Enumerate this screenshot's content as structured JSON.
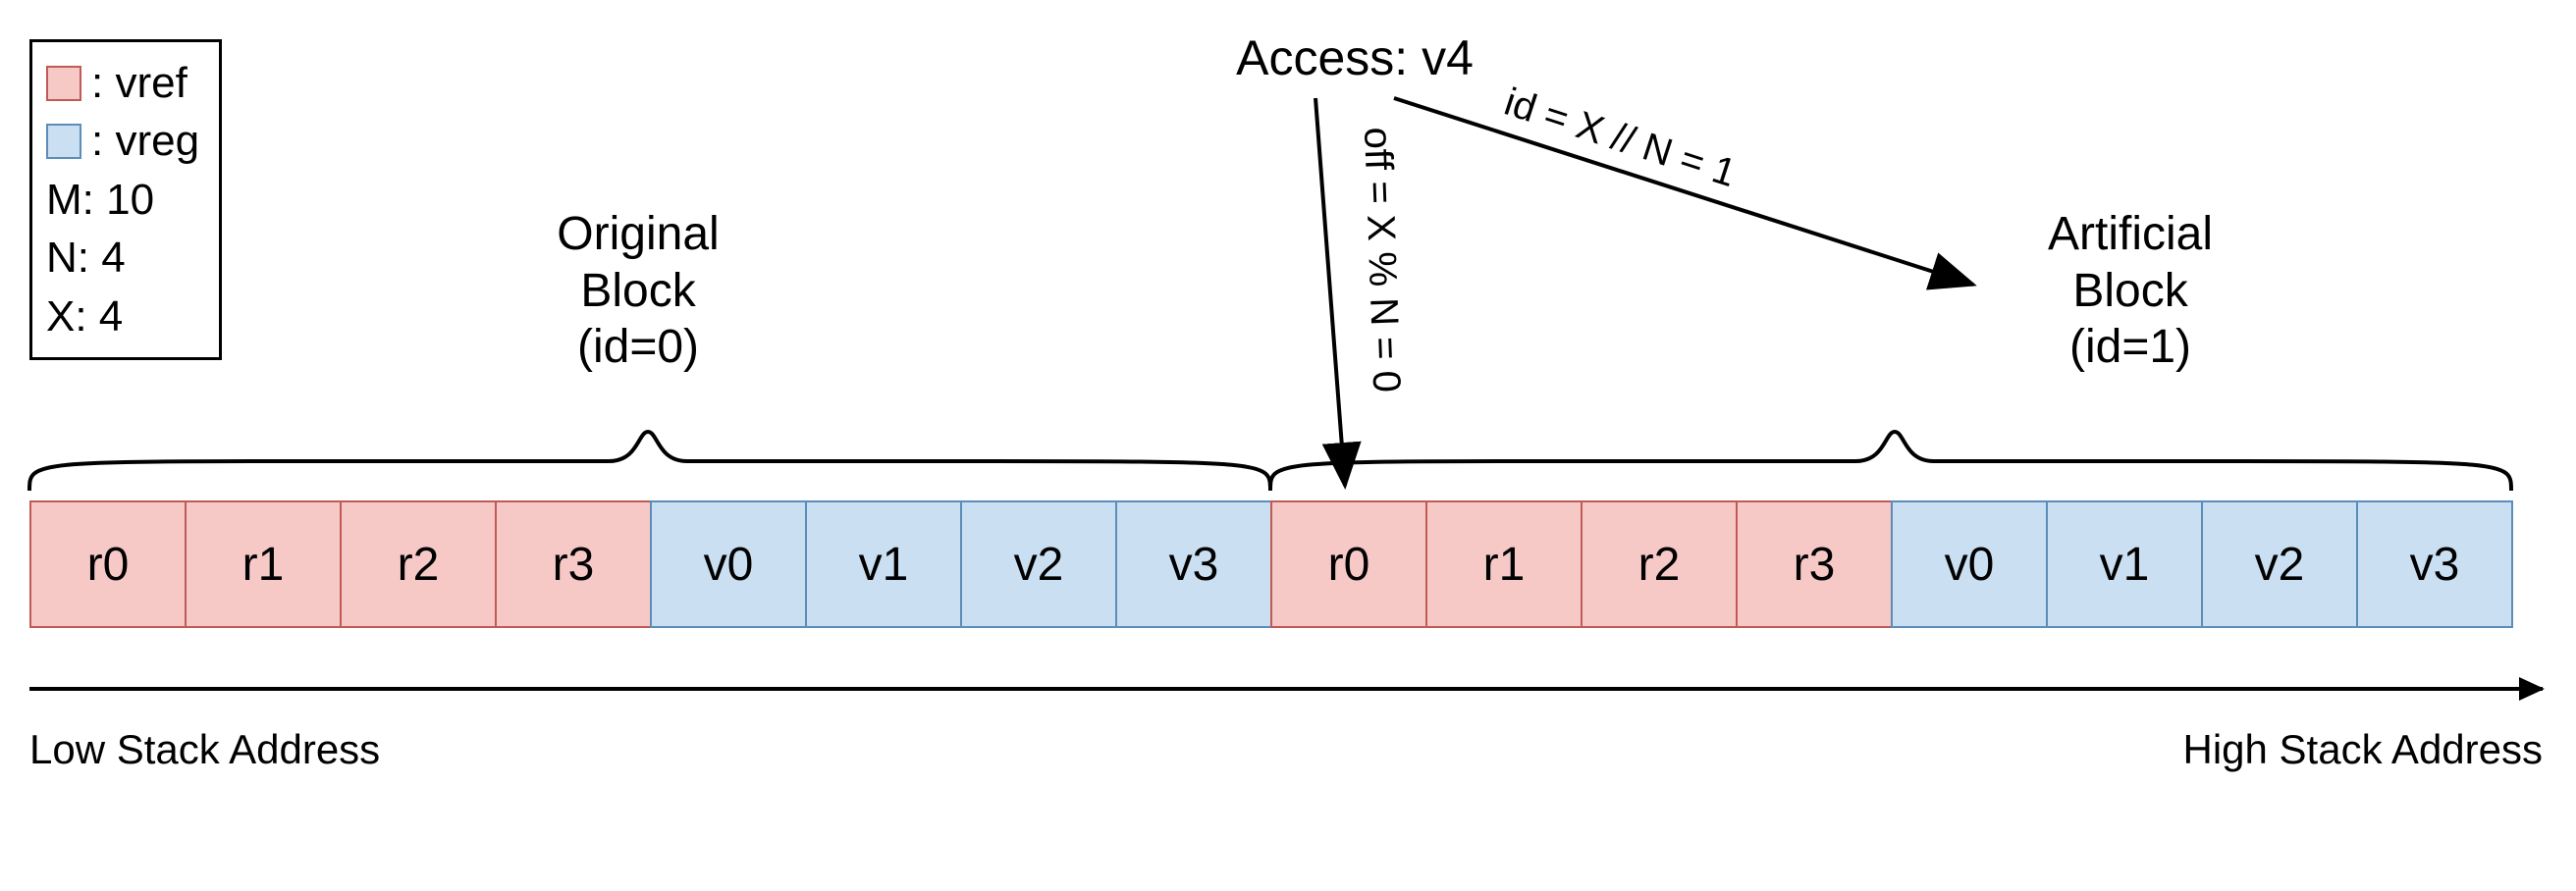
{
  "legend": {
    "vref_label": ": vref",
    "vreg_label": ": vreg",
    "m": "M: 10",
    "n": "N: 4",
    "x": "X: 4"
  },
  "access_label": "Access: v4",
  "original_block": {
    "line1": "Original",
    "line2": "Block",
    "line3": "(id=0)"
  },
  "artificial_block": {
    "line1": "Artificial",
    "line2": "Block",
    "line3": "(id=1)"
  },
  "formula_off": "off = X % N = 0",
  "formula_id": "id = X // N = 1",
  "cells": [
    {
      "label": "r0",
      "type": "vref"
    },
    {
      "label": "r1",
      "type": "vref"
    },
    {
      "label": "r2",
      "type": "vref"
    },
    {
      "label": "r3",
      "type": "vref"
    },
    {
      "label": "v0",
      "type": "vreg"
    },
    {
      "label": "v1",
      "type": "vreg"
    },
    {
      "label": "v2",
      "type": "vreg"
    },
    {
      "label": "v3",
      "type": "vreg"
    },
    {
      "label": "r0",
      "type": "vref"
    },
    {
      "label": "r1",
      "type": "vref"
    },
    {
      "label": "r2",
      "type": "vref"
    },
    {
      "label": "r3",
      "type": "vref"
    },
    {
      "label": "v0",
      "type": "vreg"
    },
    {
      "label": "v1",
      "type": "vreg"
    },
    {
      "label": "v2",
      "type": "vreg"
    },
    {
      "label": "v3",
      "type": "vreg"
    }
  ],
  "axis": {
    "low": "Low Stack Address",
    "high": "High Stack Address"
  },
  "colors": {
    "vref_fill": "#f6c9c7",
    "vref_border": "#c05a57",
    "vreg_fill": "#cadff2",
    "vreg_border": "#5b8db8"
  },
  "chart_data": {
    "type": "table",
    "title": "Memory block layout diagram",
    "parameters": {
      "M": 10,
      "N": 4,
      "X": 4
    },
    "access": "v4",
    "derived": {
      "off": 0,
      "id": 1,
      "off_formula": "X % N",
      "id_formula": "X // N"
    },
    "blocks": [
      {
        "id": 0,
        "name": "Original Block",
        "refs": [
          "r0",
          "r1",
          "r2",
          "r3"
        ],
        "regs": [
          "v0",
          "v1",
          "v2",
          "v3"
        ]
      },
      {
        "id": 1,
        "name": "Artificial Block",
        "refs": [
          "r0",
          "r1",
          "r2",
          "r3"
        ],
        "regs": [
          "v0",
          "v1",
          "v2",
          "v3"
        ]
      }
    ],
    "xlabel": "Stack Address (low → high)"
  }
}
